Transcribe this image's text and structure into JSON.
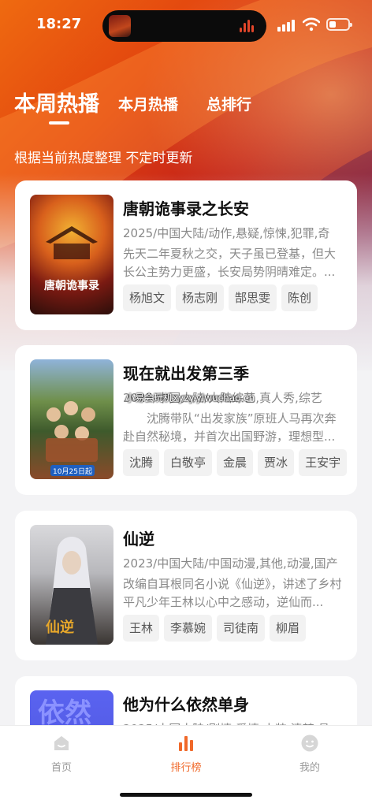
{
  "status_bar": {
    "time": "18:27"
  },
  "tabs": [
    {
      "label": "本周热播",
      "active": true
    },
    {
      "label": "本月热播",
      "active": false
    },
    {
      "label": "总排行",
      "active": false
    }
  ],
  "subtitle": "根据当前热度整理 不定时更新",
  "watermark": "小易会玩机xyzy.ylwuchao.cn",
  "cards": [
    {
      "title": "唐朝诡事录之长安",
      "meta": "2025/中国大陆/动作,悬疑,惊悚,犯罪,奇",
      "desc": "先天二年夏秋之交，天子虽已登基，但大长公主势力更盛，长安局势阴晴难定。...",
      "tags": [
        "杨旭文",
        "杨志刚",
        "郜思雯",
        "陈创"
      ],
      "poster_text": "唐朝诡事录"
    },
    {
      "title": "现在就出发第三季",
      "meta": "2025/中国大陆/大陆综艺,真人秀,综艺",
      "desc": "沈腾带队“出发家族”原班人马再次奔赴自然秘境，并首次出国野游，理想型...",
      "tags": [
        "沈腾",
        "白敬亭",
        "金晨",
        "贾冰",
        "王安宇"
      ],
      "poster_text": "10月25日起"
    },
    {
      "title": "仙逆",
      "meta": "2023/中国大陆/中国动漫,其他,动漫,国产",
      "desc": "改编自耳根同名小说《仙逆》，讲述了乡村平凡少年王林以心中之感动，逆仙而...",
      "tags": [
        "王林",
        "李慕婉",
        "司徒南",
        "柳眉"
      ],
      "poster_text": "仙逆"
    },
    {
      "title": "他为什么依然单身",
      "meta": "2025/中国大陆/剧情,爱情,古装,清梦,悬",
      "desc": "",
      "tags": [],
      "poster_text": "依然"
    }
  ],
  "bottom_nav": [
    {
      "label": "首页",
      "icon": "home-icon",
      "active": false
    },
    {
      "label": "排行榜",
      "icon": "ranking-icon",
      "active": true
    },
    {
      "label": "我的",
      "icon": "profile-icon",
      "active": false
    }
  ],
  "colors": {
    "accent": "#f0692a",
    "hero": "#e2440f"
  }
}
